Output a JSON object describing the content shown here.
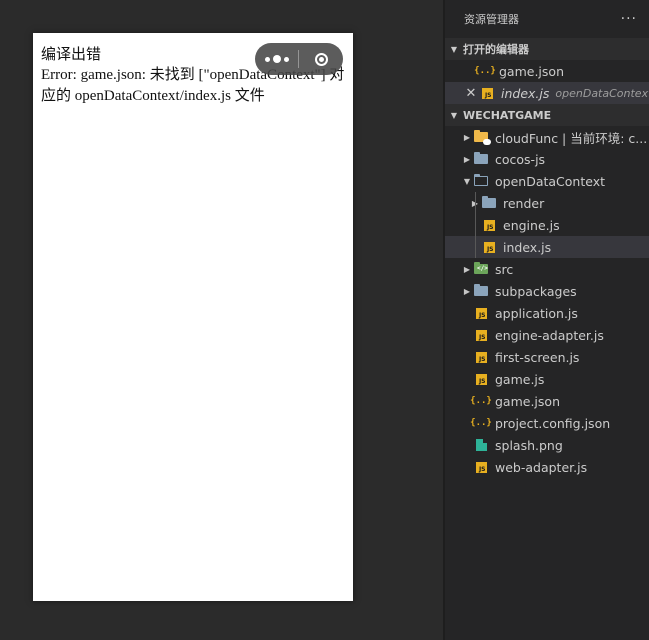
{
  "simulator": {
    "error_title": "编译出错",
    "error_message": "Error: game.json: 未找到 [\"openDataContext\"] 对应的 openDataContext/index.js 文件"
  },
  "explorer": {
    "title": "资源管理器",
    "more": "···",
    "open_editors": {
      "label": "打开的编辑器",
      "items": [
        {
          "name": "game.json",
          "icon": "json-icon"
        },
        {
          "name": "index.js",
          "icon": "js-icon",
          "description": "openDataContext"
        }
      ]
    },
    "project": {
      "label": "WECHATGAME",
      "items": [
        {
          "name": "cloudFunc | 当前环境: c...",
          "icon": "cloud-folder-icon"
        },
        {
          "name": "cocos-js",
          "icon": "folder-icon"
        },
        {
          "name": "openDataContext",
          "icon": "folder-open-icon"
        },
        {
          "name": "render",
          "icon": "folder-icon"
        },
        {
          "name": "engine.js",
          "icon": "js-icon"
        },
        {
          "name": "index.js",
          "icon": "js-icon"
        },
        {
          "name": "src",
          "icon": "src-folder-icon"
        },
        {
          "name": "subpackages",
          "icon": "folder-icon"
        },
        {
          "name": "application.js",
          "icon": "js-icon"
        },
        {
          "name": "engine-adapter.js",
          "icon": "js-icon"
        },
        {
          "name": "first-screen.js",
          "icon": "js-icon"
        },
        {
          "name": "game.js",
          "icon": "js-icon"
        },
        {
          "name": "game.json",
          "icon": "json-icon"
        },
        {
          "name": "project.config.json",
          "icon": "json-icon"
        },
        {
          "name": "splash.png",
          "icon": "image-icon"
        },
        {
          "name": "web-adapter.js",
          "icon": "js-icon"
        }
      ]
    }
  },
  "colors": {
    "background": "#2b2b2b",
    "sidebar": "#252526",
    "selection": "#37373d",
    "js_badge": "#e8b020",
    "folder": "#8ba4bb"
  }
}
